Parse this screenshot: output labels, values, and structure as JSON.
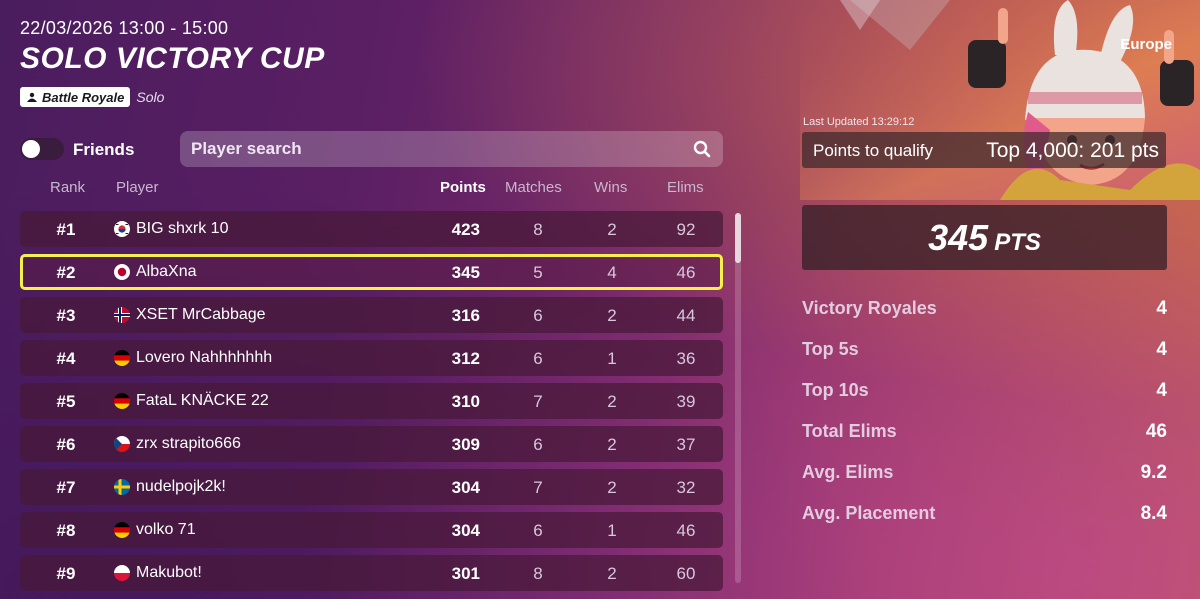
{
  "header": {
    "datetime": "22/03/2026 13:00 - 15:00",
    "title": "SOLO VICTORY CUP",
    "mode_badge": "Battle Royale",
    "mode_type": "Solo"
  },
  "controls": {
    "friends_label": "Friends",
    "friends_toggle_on": false,
    "search_placeholder": "Player search"
  },
  "table": {
    "columns": {
      "rank": "Rank",
      "player": "Player",
      "points": "Points",
      "matches": "Matches",
      "wins": "Wins",
      "elims": "Elims"
    },
    "rows": [
      {
        "rank": "#1",
        "flag": "kr-flag-icon",
        "player": "BIG shxrk 10",
        "points": "423",
        "matches": "8",
        "wins": "2",
        "elims": "92"
      },
      {
        "rank": "#2",
        "flag": "jp-flag-icon",
        "player": "AlbaXna",
        "points": "345",
        "matches": "5",
        "wins": "4",
        "elims": "46"
      },
      {
        "rank": "#3",
        "flag": "no-flag-icon",
        "player": "XSET MrCabbage",
        "points": "316",
        "matches": "6",
        "wins": "2",
        "elims": "44"
      },
      {
        "rank": "#4",
        "flag": "de-flag-icon",
        "player": "Lovero Nahhhhhhh",
        "points": "312",
        "matches": "6",
        "wins": "1",
        "elims": "36"
      },
      {
        "rank": "#5",
        "flag": "de-flag-icon",
        "player": "FataL KNÄCKE 22",
        "points": "310",
        "matches": "7",
        "wins": "2",
        "elims": "39"
      },
      {
        "rank": "#6",
        "flag": "cz-flag-icon",
        "player": "zrx strapito666",
        "points": "309",
        "matches": "6",
        "wins": "2",
        "elims": "37"
      },
      {
        "rank": "#7",
        "flag": "se-flag-icon",
        "player": "nudelpojk2k!",
        "points": "304",
        "matches": "7",
        "wins": "2",
        "elims": "32"
      },
      {
        "rank": "#8",
        "flag": "de-flag-icon",
        "player": "volko 71",
        "points": "304",
        "matches": "6",
        "wins": "1",
        "elims": "46"
      },
      {
        "rank": "#9",
        "flag": "pl-flag-icon",
        "player": "Makubot!",
        "points": "301",
        "matches": "8",
        "wins": "2",
        "elims": "60"
      }
    ]
  },
  "sidebar": {
    "region": "Europe",
    "last_updated": "Last Updated 13:29:12",
    "qualify_label": "Points to qualify",
    "qualify_value": "Top 4,000: 201 pts",
    "score": "345",
    "score_unit": "PTS",
    "stats": [
      {
        "label": "Victory Royales",
        "value": "4"
      },
      {
        "label": "Top 5s",
        "value": "4"
      },
      {
        "label": "Top 10s",
        "value": "4"
      },
      {
        "label": "Total Elims",
        "value": "46"
      },
      {
        "label": "Avg. Elims",
        "value": "9.2"
      },
      {
        "label": "Avg. Placement",
        "value": "8.4"
      }
    ]
  },
  "colors": {
    "highlight_border": "#f4f04a",
    "row_bg": "#461937",
    "accent_white": "#ffffff"
  }
}
